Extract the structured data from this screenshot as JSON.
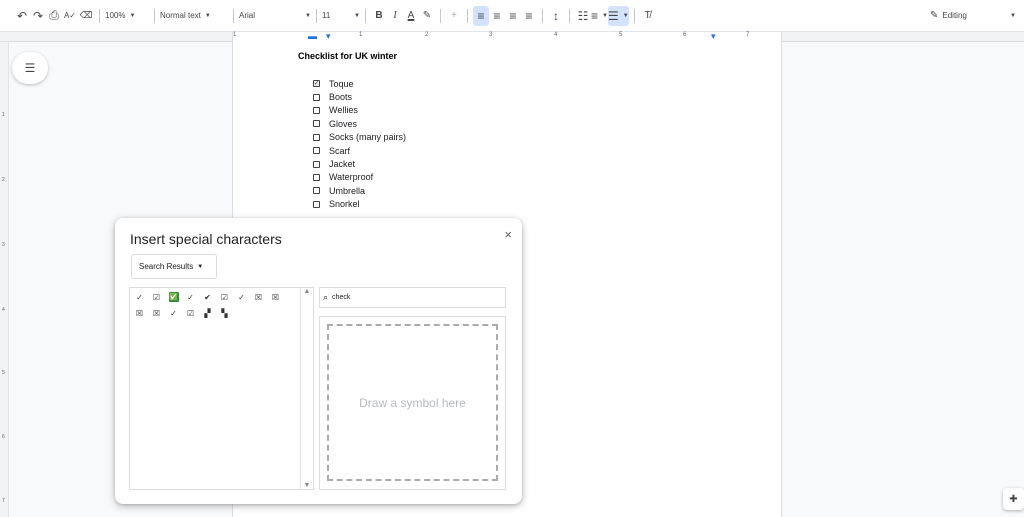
{
  "toolbar": {
    "undo_icon": "↶",
    "redo_icon": "↷",
    "print_icon": "⎙",
    "spellcheck_icon": "A✓",
    "paint_format_icon": "⌫",
    "zoom": "100%",
    "style": "Normal text",
    "font": "Arial",
    "font_size": "11",
    "bold": "B",
    "italic": "I",
    "text_color": "A",
    "highlight_icon": "✎",
    "insert_icon": "+",
    "line_spacing_icon": "↕",
    "numbered_list_icon": "≡",
    "bulleted_list_icon": "☰",
    "clear_format_icon": "T̸",
    "mode": "Editing"
  },
  "ruler": {
    "numbers": [
      "1",
      "1",
      "2",
      "3",
      "4",
      "5",
      "6",
      "7"
    ]
  },
  "vruler": {
    "numbers": [
      "1",
      "2",
      "3",
      "4",
      "5",
      "6",
      "7"
    ]
  },
  "document": {
    "title": "Checklist for UK winter",
    "items": [
      {
        "label": "Toque",
        "checked": true
      },
      {
        "label": "Boots",
        "checked": false
      },
      {
        "label": "Wellies",
        "checked": false
      },
      {
        "label": "Gloves",
        "checked": false
      },
      {
        "label": "Socks (many pairs)",
        "checked": false
      },
      {
        "label": "Scarf",
        "checked": false
      },
      {
        "label": "Jacket",
        "checked": false
      },
      {
        "label": "Waterproof",
        "checked": false
      },
      {
        "label": "Umbrella",
        "checked": false
      },
      {
        "label": "Snorkel",
        "checked": false
      }
    ]
  },
  "dialog": {
    "title": "Insert special characters",
    "close": "×",
    "category": "Search Results",
    "search_value": "check",
    "draw_placeholder": "Draw a symbol here",
    "characters": [
      "✓",
      "☑",
      "✅",
      "✓",
      "✔",
      "☑",
      "✓",
      "☒",
      "☒",
      "☒",
      "☒",
      "✓",
      "☑",
      "▞",
      "▚"
    ]
  },
  "colors": {
    "accent": "#1a73e8",
    "green": "#1e8e3e"
  }
}
